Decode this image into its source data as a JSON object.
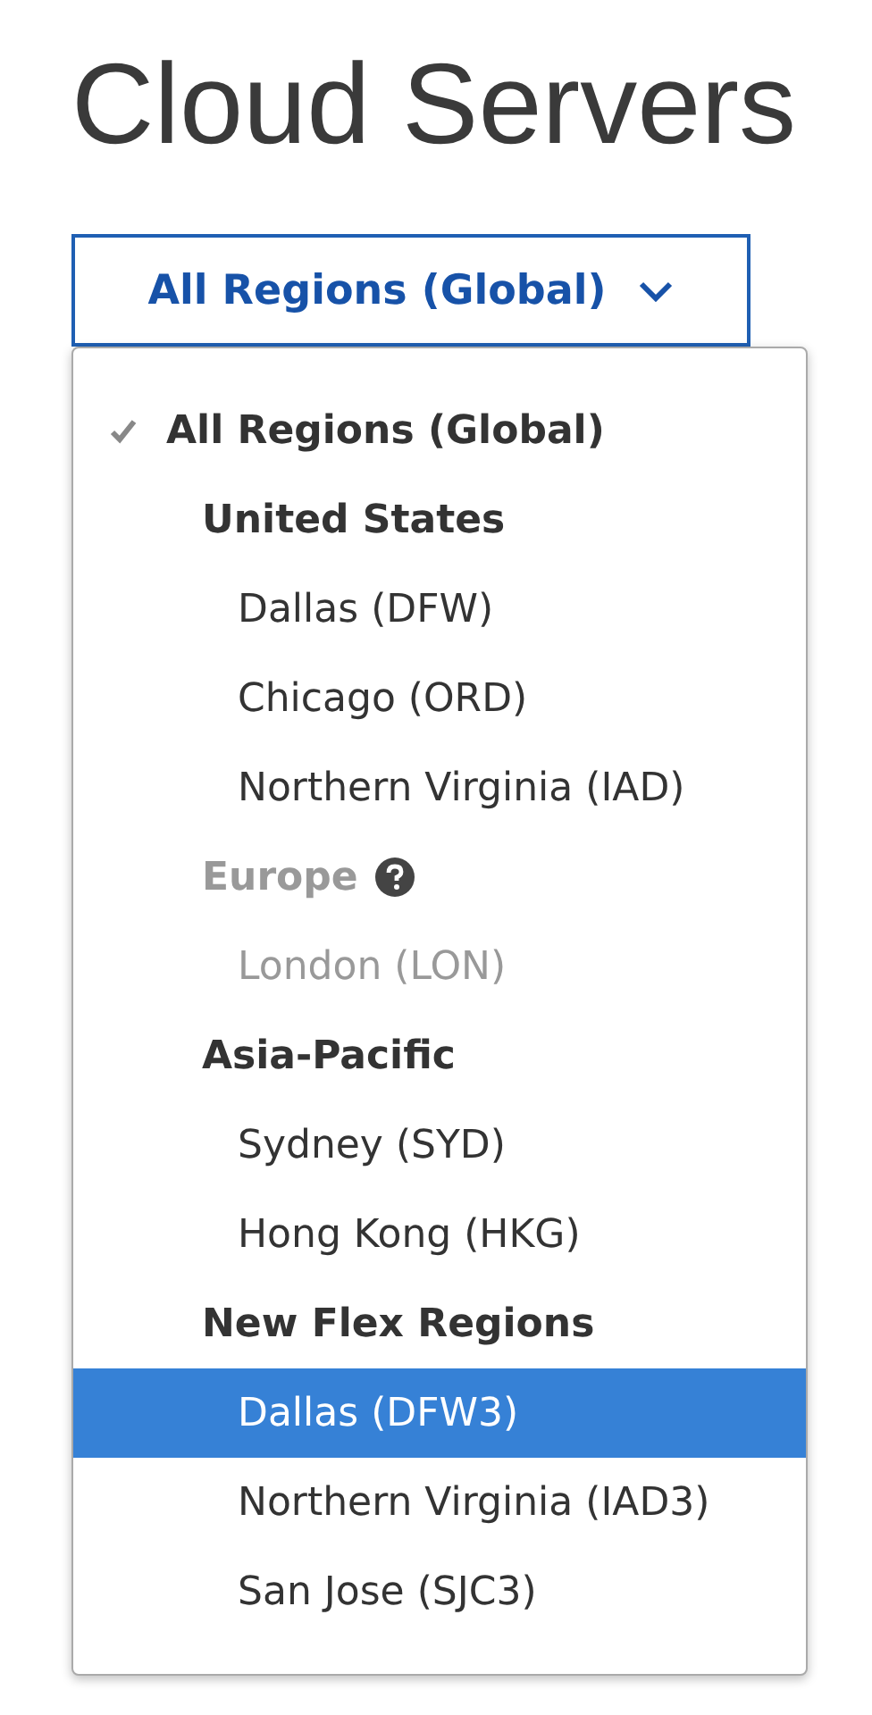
{
  "title": "Cloud Servers",
  "dropdown": {
    "label": "All Regions (Global)",
    "expanded": true
  },
  "menu": {
    "items": [
      {
        "label": "All Regions (Global)",
        "checked": true,
        "selected": false,
        "disabled": false,
        "help_icon": false,
        "children": [
          {
            "label": "United States",
            "checked": false,
            "selected": false,
            "disabled": false,
            "help_icon": false,
            "children": [
              {
                "label": "Dallas (DFW)",
                "checked": false,
                "selected": false,
                "disabled": false,
                "help_icon": false
              },
              {
                "label": "Chicago (ORD)",
                "checked": false,
                "selected": false,
                "disabled": false,
                "help_icon": false
              },
              {
                "label": "Northern Virginia (IAD)",
                "checked": false,
                "selected": false,
                "disabled": false,
                "help_icon": false
              }
            ]
          },
          {
            "label": "Europe",
            "checked": false,
            "selected": false,
            "disabled": true,
            "help_icon": true,
            "children": [
              {
                "label": "London (LON)",
                "checked": false,
                "selected": false,
                "disabled": true,
                "help_icon": false
              }
            ]
          },
          {
            "label": "Asia-Pacific",
            "checked": false,
            "selected": false,
            "disabled": false,
            "help_icon": false,
            "children": [
              {
                "label": "Sydney (SYD)",
                "checked": false,
                "selected": false,
                "disabled": false,
                "help_icon": false
              },
              {
                "label": "Hong Kong (HKG)",
                "checked": false,
                "selected": false,
                "disabled": false,
                "help_icon": false
              }
            ]
          },
          {
            "label": "New Flex Regions",
            "checked": false,
            "selected": false,
            "disabled": false,
            "help_icon": false,
            "children": [
              {
                "label": "Dallas (DFW3)",
                "checked": false,
                "selected": true,
                "disabled": false,
                "help_icon": false
              },
              {
                "label": "Northern Virginia (IAD3)",
                "checked": false,
                "selected": false,
                "disabled": false,
                "help_icon": false
              },
              {
                "label": "San Jose (SJC3)",
                "checked": false,
                "selected": false,
                "disabled": false,
                "help_icon": false
              }
            ]
          }
        ]
      }
    ]
  }
}
